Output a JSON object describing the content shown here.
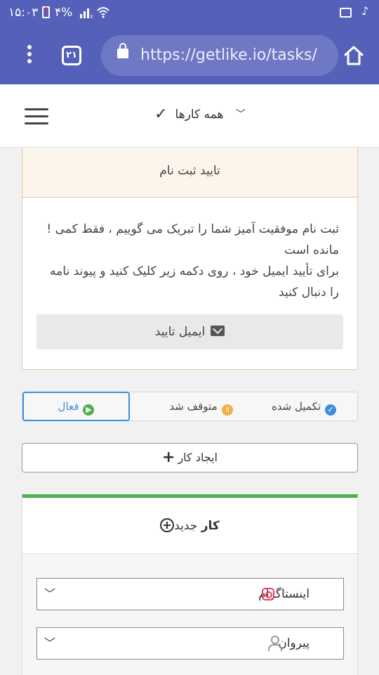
{
  "status_bar": {
    "time": "۱۵:۰۳",
    "battery": "۴%",
    "icons": [
      "battery-alert-icon",
      "signal-icon",
      "wifi-icon",
      "image-icon",
      "tiktok-icon"
    ]
  },
  "browser": {
    "tab_count": "۲۱",
    "url": "https://getlike.io/tasks/",
    "icons": [
      "menu-dots-icon",
      "lock-icon",
      "home-icon"
    ]
  },
  "nav": {
    "title": "همه کارها",
    "icons": [
      "hamburger-icon",
      "check-icon",
      "chevron-down-icon"
    ]
  },
  "confirm": {
    "title": "تایید ثبت نام",
    "line1": "ثبت نام موفقیت آمیز شما را تبریک می گوییم ، فقط کمی !مانده است",
    "line2": "برای تأیید ایمیل خود ، روی دکمه زیر کلیک کنید و پیوند نامه را دنبال کنید",
    "button": "ایمیل تایید"
  },
  "tabs": [
    {
      "label": "تکمیل شده",
      "icon": "check-circle-icon",
      "color": "#3d8fdd"
    },
    {
      "label": "متوقف شد",
      "icon": "pause-circle-icon",
      "color": "#f0ad4e"
    },
    {
      "label": "فعال",
      "icon": "play-circle-icon",
      "color": "#4caf50"
    }
  ],
  "create_button": "ایجاد کار",
  "new_task": {
    "title_bold": "کار",
    "title_rest": " جدید",
    "network_select": "اینستاگرام",
    "type_select": "پیروان"
  },
  "colors": {
    "brand": "#5561b8",
    "active_tab": "#3d8fdd",
    "card_accent": "#4caf50"
  }
}
